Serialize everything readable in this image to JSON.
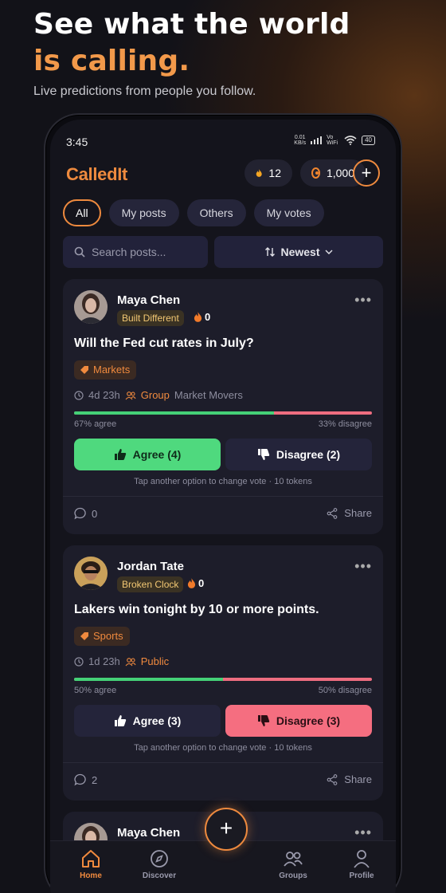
{
  "promo": {
    "headline_1": "See what the world",
    "headline_2": "is calling.",
    "subtitle": "Live predictions from people you follow."
  },
  "status": {
    "time": "3:45",
    "speed_top": "0.01",
    "speed_bottom": "KB/s",
    "network": "Vo WiFi",
    "battery": "40"
  },
  "app": {
    "title": "CalledIt",
    "streak_count": "12",
    "token_balance": "1,000"
  },
  "filters": [
    {
      "label": "All",
      "active": true
    },
    {
      "label": "My posts",
      "active": false
    },
    {
      "label": "Others",
      "active": false
    },
    {
      "label": "My votes",
      "active": false
    }
  ],
  "search": {
    "placeholder": "Search posts..."
  },
  "sort": {
    "label": "Newest"
  },
  "posts": [
    {
      "author": "Maya Chen",
      "badge": "Built Different",
      "streak": "0",
      "question": "Will the Fed cut rates in July?",
      "tag": "Markets",
      "time_left": "4d 23h",
      "visibility": "Group",
      "group_name": "Market Movers",
      "agree_pct": 67,
      "agree_text": "67% agree",
      "disagree_text": "33% disagree",
      "agree_label": "Agree (4)",
      "disagree_label": "Disagree (2)",
      "hint": "Tap another option to change vote · 10 tokens",
      "comments": "0",
      "share": "Share"
    },
    {
      "author": "Jordan Tate",
      "badge": "Broken Clock",
      "streak": "0",
      "question": "Lakers win tonight by 10 or more points.",
      "tag": "Sports",
      "time_left": "1d 23h",
      "visibility": "Public",
      "agree_pct": 50,
      "agree_text": "50% agree",
      "disagree_text": "50% disagree",
      "agree_label": "Agree (3)",
      "disagree_label": "Disagree (3)",
      "hint": "Tap another option to change vote · 10 tokens",
      "comments": "2",
      "share": "Share"
    },
    {
      "author": "Maya Chen"
    }
  ],
  "tabs": [
    {
      "label": "Home",
      "icon": "home-icon",
      "active": true
    },
    {
      "label": "Discover",
      "icon": "compass-icon",
      "active": false
    },
    {
      "label": "Groups",
      "icon": "groups-icon",
      "active": false
    },
    {
      "label": "Profile",
      "icon": "profile-icon",
      "active": false
    }
  ],
  "colors": {
    "accent": "#ee8a3e",
    "agree": "#45d177",
    "disagree": "#ee6d80",
    "card": "#1d1d2a",
    "screen": "#14141c"
  }
}
